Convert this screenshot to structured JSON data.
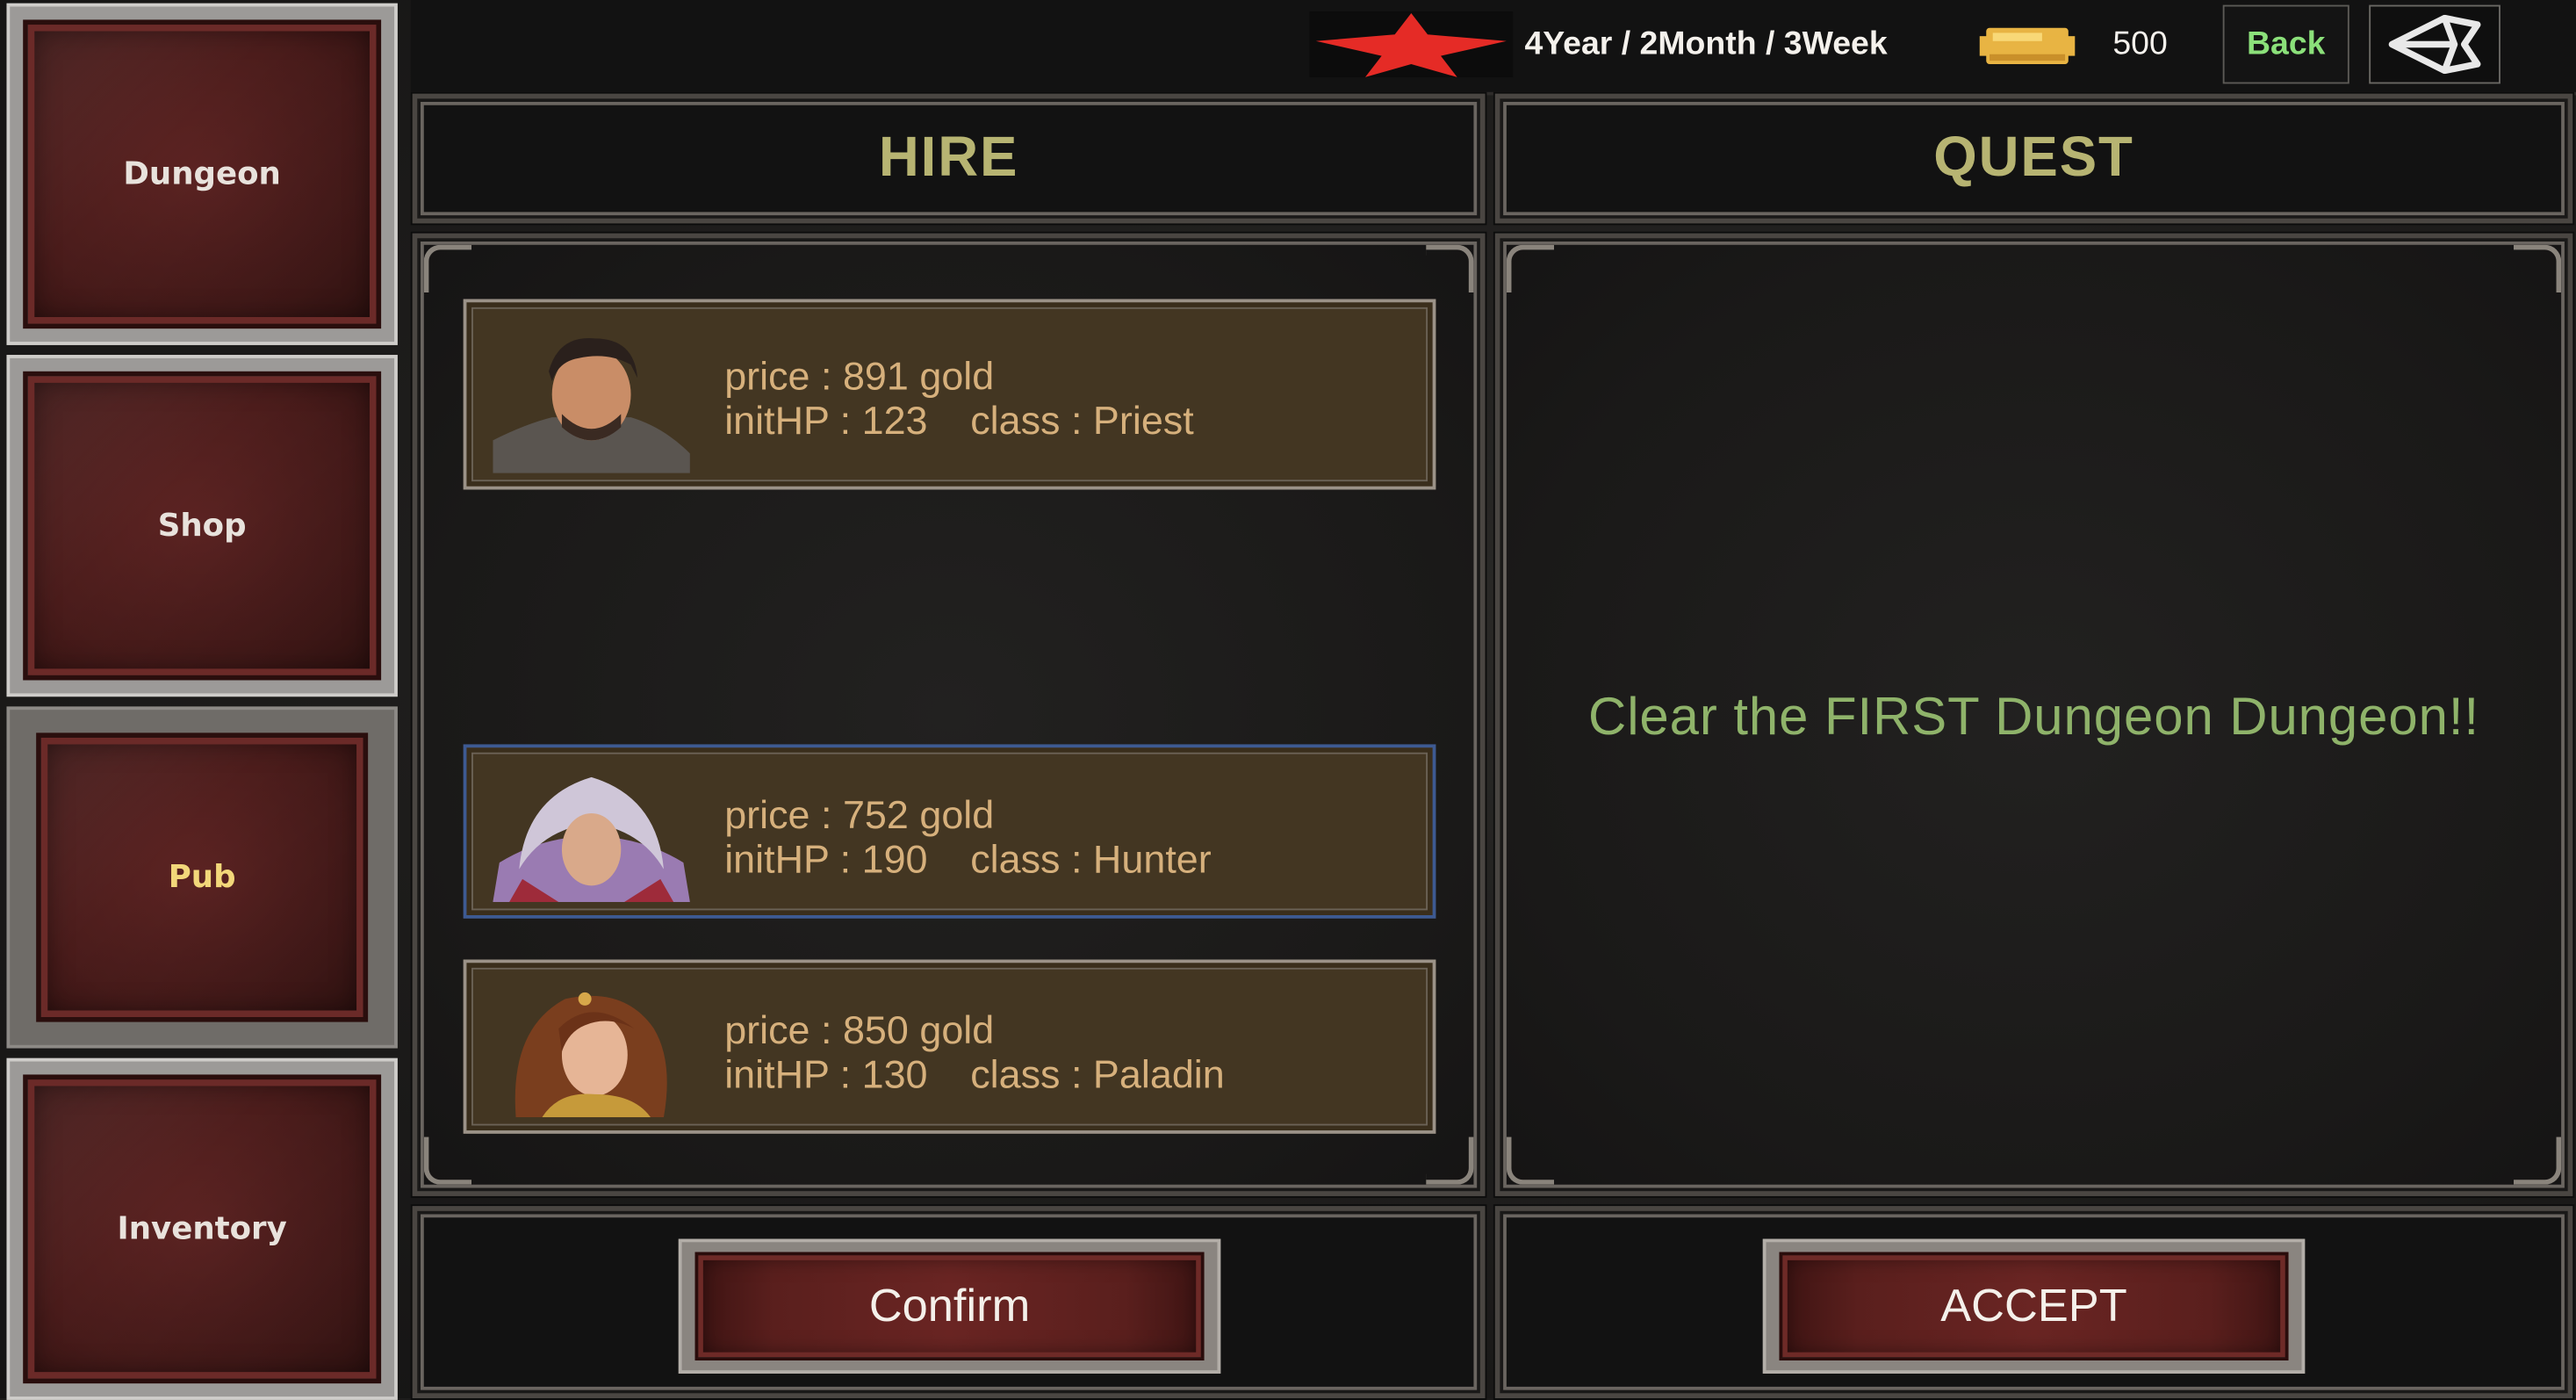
{
  "sidebar": {
    "items": [
      {
        "label": "Dungeon"
      },
      {
        "label": "Shop"
      },
      {
        "label": "Pub"
      },
      {
        "label": "Inventory"
      }
    ],
    "active_index": 2
  },
  "topbar": {
    "date": "4Year / 2Month / 3Week",
    "gold": "500",
    "back_label": "Back"
  },
  "hire": {
    "title": "HIRE",
    "candidates": [
      {
        "price": "price : 891 gold",
        "hp": "initHP : 123",
        "class": "class : Priest"
      },
      {
        "price": "price : 752 gold",
        "hp": "initHP : 190",
        "class": "class : Hunter"
      },
      {
        "price": "price : 850 gold",
        "hp": "initHP : 130",
        "class": "class : Paladin"
      }
    ],
    "confirm_label": "Confirm"
  },
  "quest": {
    "title": "QUEST",
    "description": "Clear the FIRST Dungeon Dungeon!!",
    "accept_label": "ACCEPT"
  },
  "colors": {
    "accent_title": "#b7b472",
    "quest_text": "#8fb36a",
    "back_text": "#8be07a",
    "card_bg": "#433622",
    "card_text": "#d6b07c",
    "selected_border": "#3d5a92"
  },
  "icons": [
    "star-icon",
    "gold-bar-icon",
    "unity-logo-icon"
  ]
}
